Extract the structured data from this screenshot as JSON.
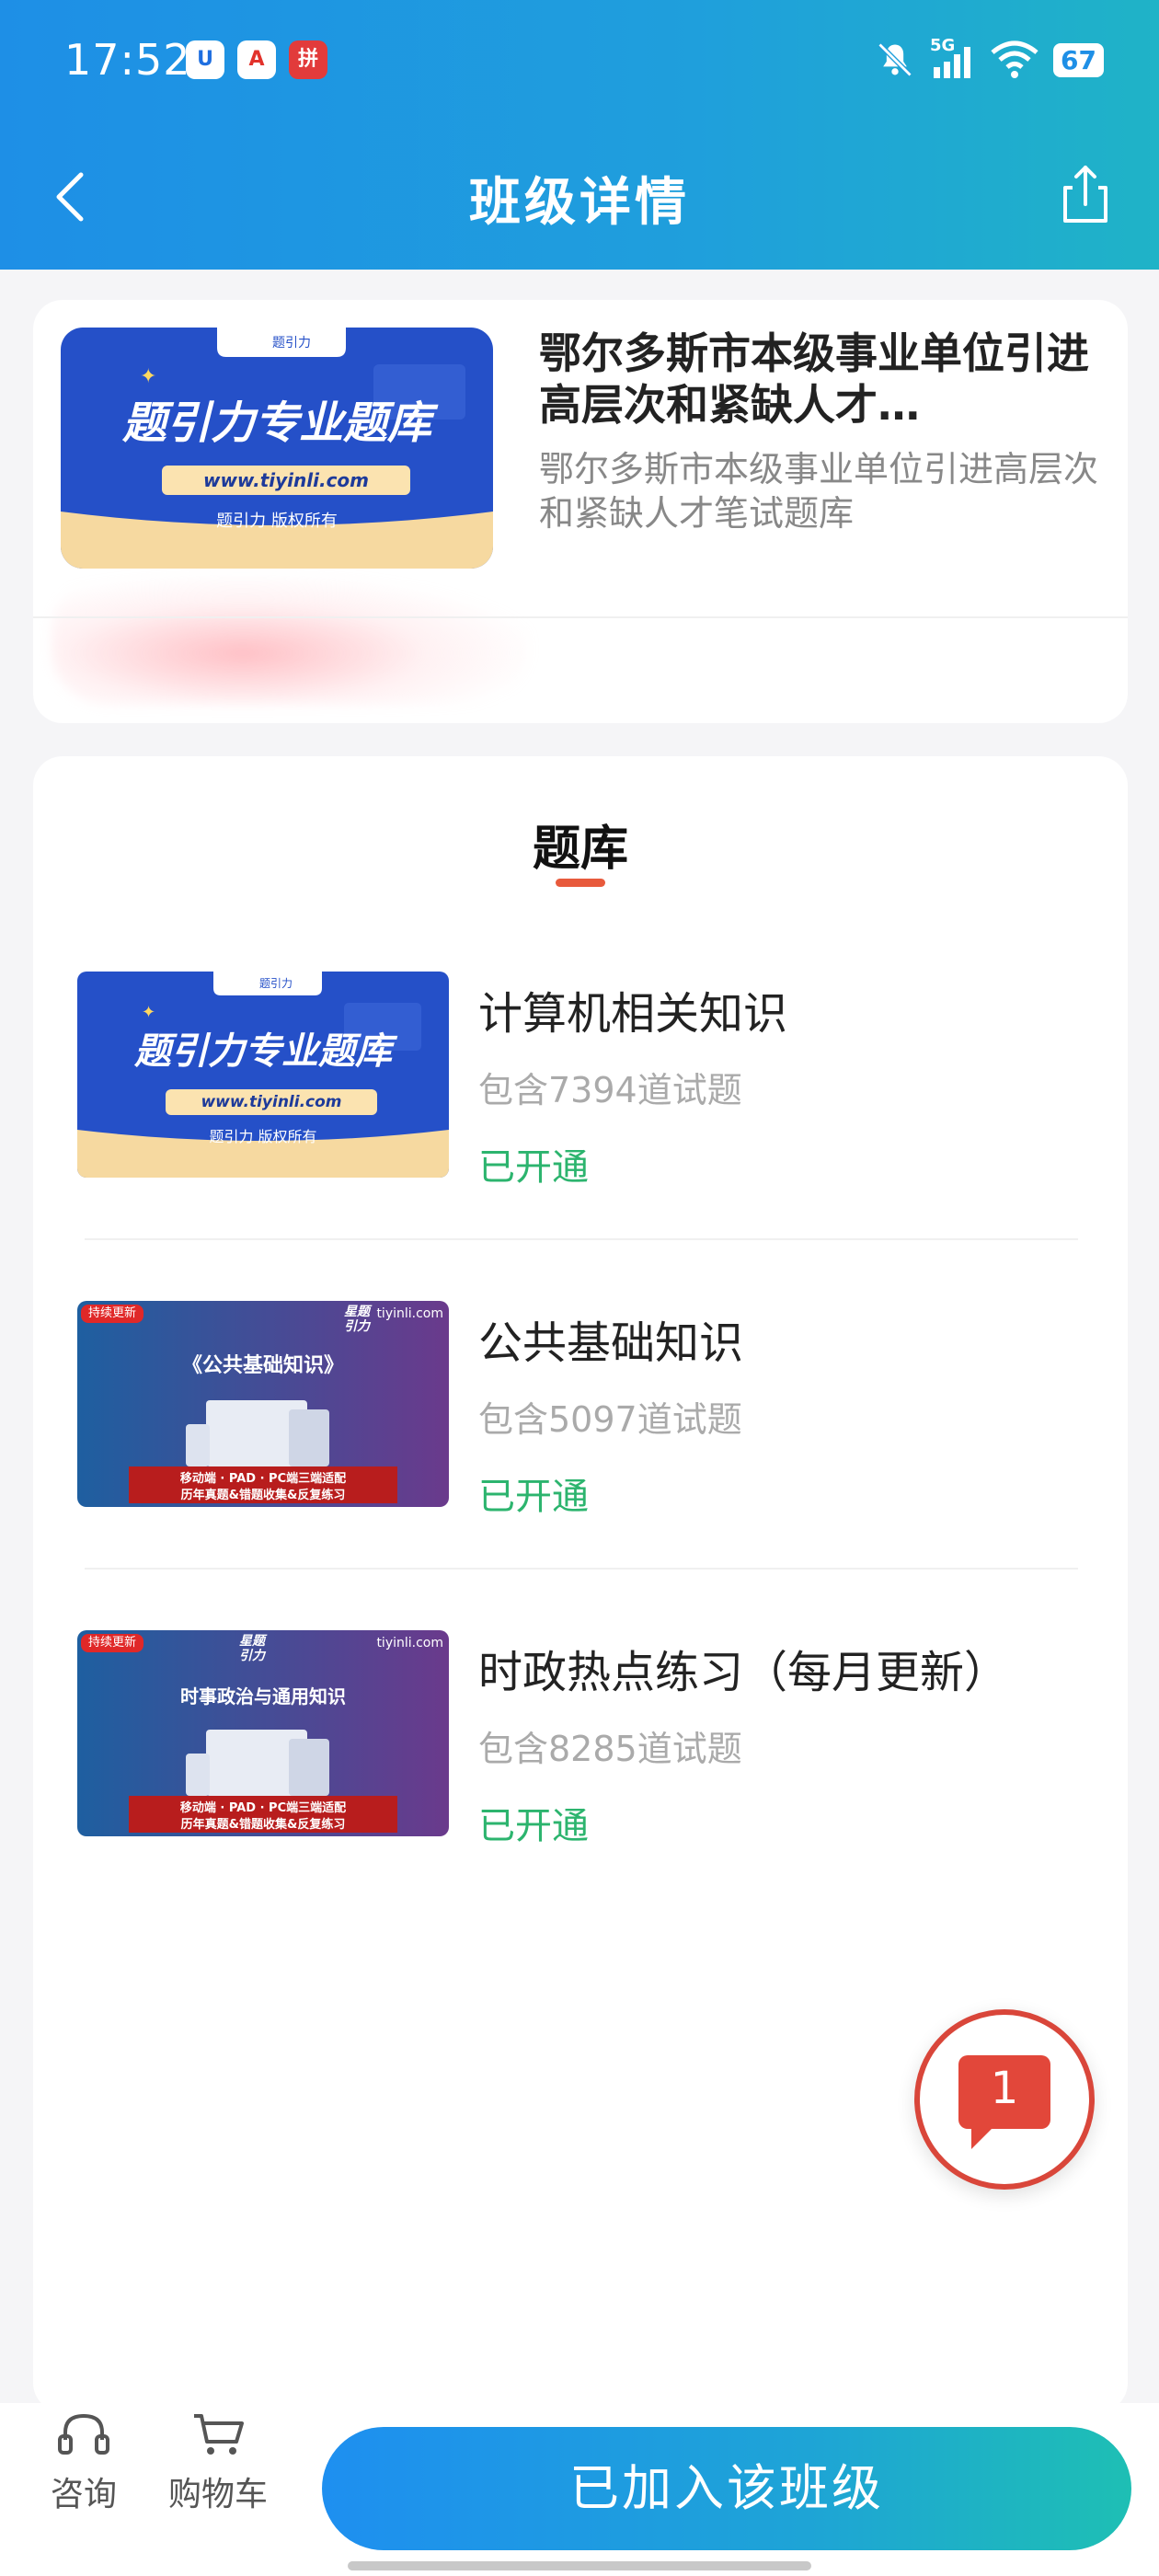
{
  "status_bar": {
    "time": "17:52",
    "network": "5G",
    "battery": "67",
    "apps": [
      "U",
      "A",
      "拼"
    ]
  },
  "header": {
    "title": "班级详情"
  },
  "class_info": {
    "thumb": {
      "title": "题引力专业题库",
      "url": "www.tiyinli.com",
      "copyright": "题引力 版权所有",
      "tag": "题引力"
    },
    "title": "鄂尔多斯市本级事业单位引进高层次和紧缺人才…",
    "description": "鄂尔多斯市本级事业单位引进高层次和紧缺人才笔试题库"
  },
  "section": {
    "title": "题库"
  },
  "banks": [
    {
      "name": "计算机相关知识",
      "count": "包含7394道试题",
      "status": "已开通",
      "thumb": {
        "title": "题引力专业题库",
        "url": "www.tiyinli.com",
        "copyright": "题引力 版权所有",
        "tag": "题引力"
      }
    },
    {
      "name": "公共基础知识",
      "count": "包含5097道试题",
      "status": "已开通",
      "thumb": {
        "badge": "持续更新",
        "site": "tiyinli.com",
        "logo": "星题引力",
        "title": "《公共基础知识》",
        "line1": "移动端 · PAD · PC端三端适配",
        "line2": "历年真题&错题收集&反复练习"
      }
    },
    {
      "name": "时政热点练习（每月更新）",
      "count": "包含8285道试题",
      "status": "已开通",
      "thumb": {
        "badge": "持续更新",
        "site": "tiyinli.com",
        "logo": "星题引力",
        "title": "时事政治与通用知识",
        "line1": "移动端 · PAD · PC端三端适配",
        "line2": "历年真题&错题收集&反复练习"
      }
    }
  ],
  "float_message": {
    "count": "1"
  },
  "bottom_bar": {
    "consult_label": "咨询",
    "cart_label": "购物车",
    "join_label": "已加入该班级"
  },
  "colors": {
    "header_start": "#1e8fe6",
    "header_end": "#1fb3c7",
    "accent_underline": "#e85a3c",
    "status_green": "#2cb46e",
    "message_red": "#e2473a"
  }
}
